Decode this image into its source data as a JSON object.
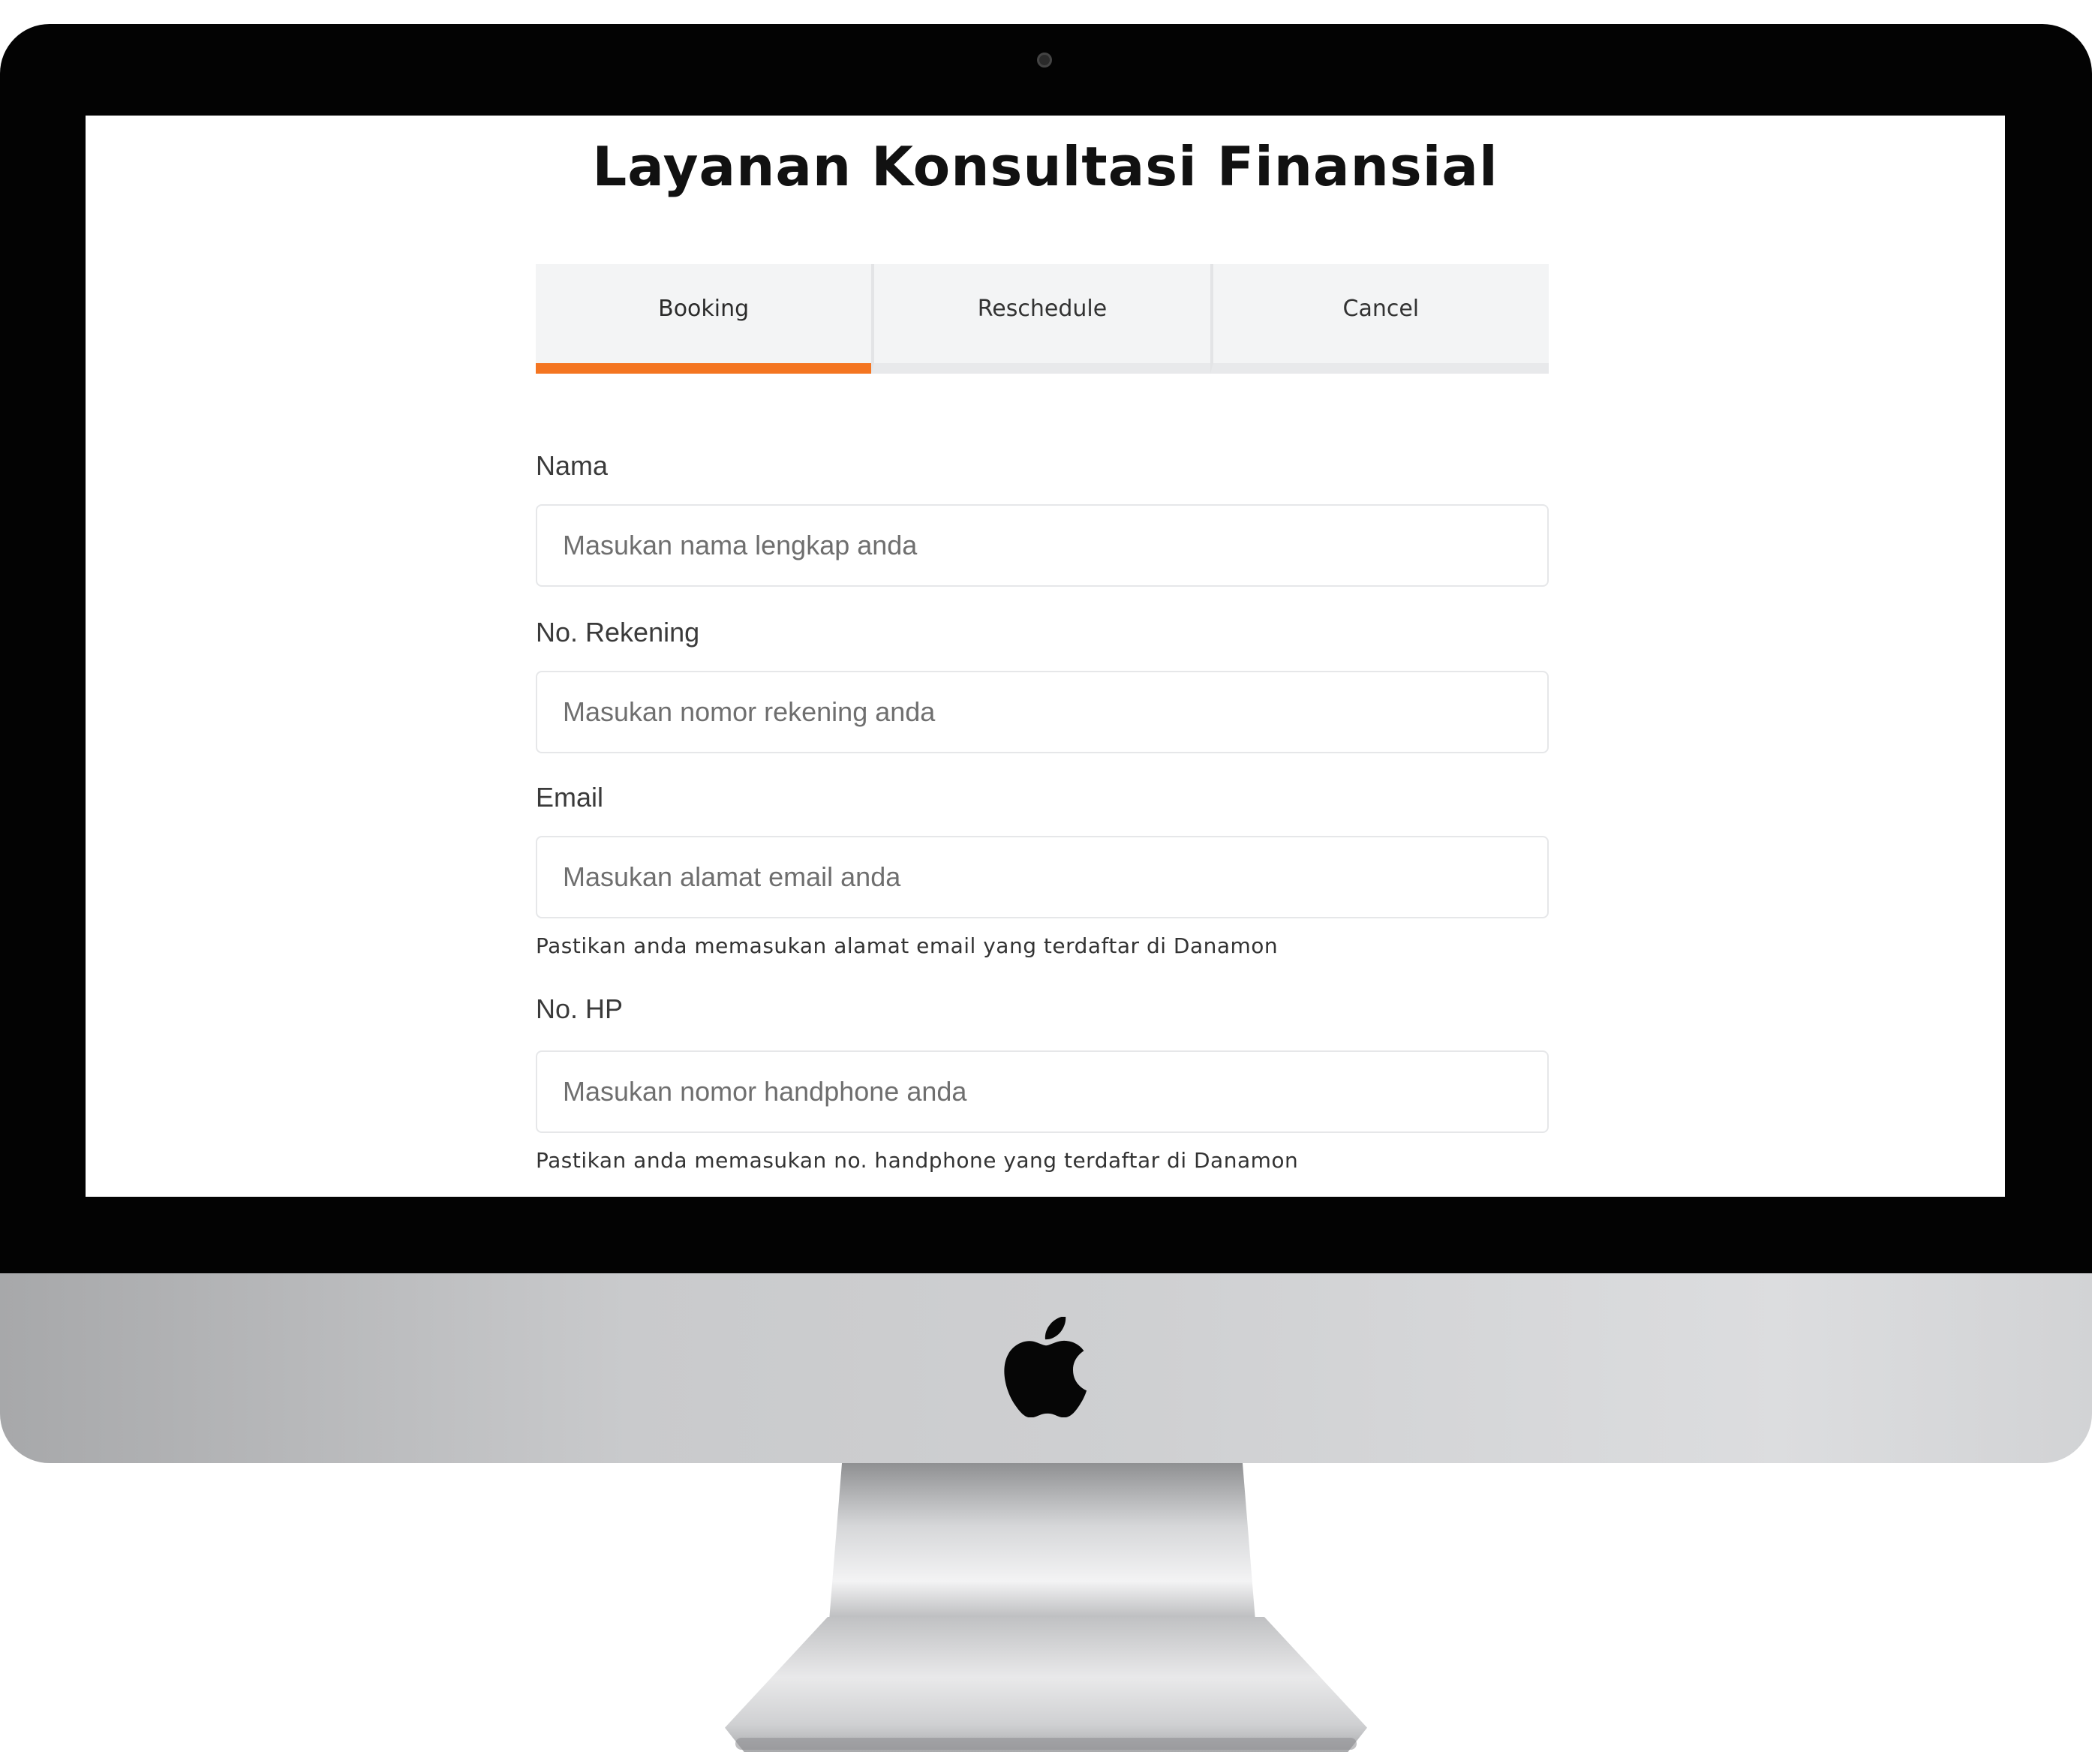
{
  "page": {
    "title": "Layanan Konsultasi Finansial"
  },
  "tabs": [
    {
      "label": "Booking",
      "active": true
    },
    {
      "label": "Reschedule",
      "active": false
    },
    {
      "label": "Cancel",
      "active": false
    }
  ],
  "form": {
    "nama": {
      "label": "Nama",
      "placeholder": "Masukan nama lengkap anda",
      "value": ""
    },
    "rekening": {
      "label": "No. Rekening",
      "placeholder": "Masukan nomor rekening anda",
      "value": ""
    },
    "email": {
      "label": "Email",
      "placeholder": "Masukan alamat email anda",
      "value": "",
      "hint": "Pastikan anda memasukan alamat email yang terdaftar di Danamon"
    },
    "hp": {
      "label": "No. HP",
      "placeholder": "Masukan nomor handphone anda",
      "value": "",
      "hint": "Pastikan anda memasukan no. handphone yang terdaftar di Danamon"
    }
  },
  "colors": {
    "accent": "#f47521",
    "tab_background": "#f3f4f5",
    "bezel": "#030303"
  },
  "icons": {
    "brand_logo": "apple-logo-icon",
    "camera": "camera-icon"
  }
}
